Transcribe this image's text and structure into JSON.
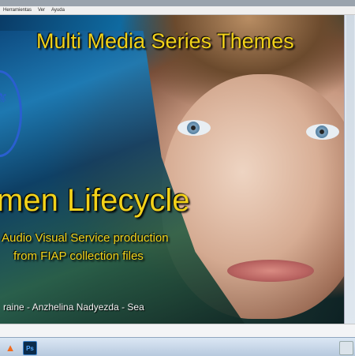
{
  "menu": {
    "items": [
      "Herramientas",
      "Ver",
      "Ayuda"
    ]
  },
  "slide": {
    "series_title": "Multi Media Series Themes",
    "main_title": "men Lifecycle",
    "subtitle_line1": "Audio Visual Service production",
    "subtitle_line2": "from FIAP collection files",
    "credit": "raine - Anzhelina Nadyezda - Sea"
  },
  "taskbar": {
    "items": [
      {
        "icon": "vlc-icon"
      },
      {
        "icon": "photoshop-icon",
        "label": "Ps"
      },
      {
        "icon": "window-thumbnail-icon"
      }
    ]
  },
  "colors": {
    "title_yellow": "#f2d21a",
    "logo_blue": "#2a5fd0",
    "credit_white": "#f3f3f3"
  }
}
